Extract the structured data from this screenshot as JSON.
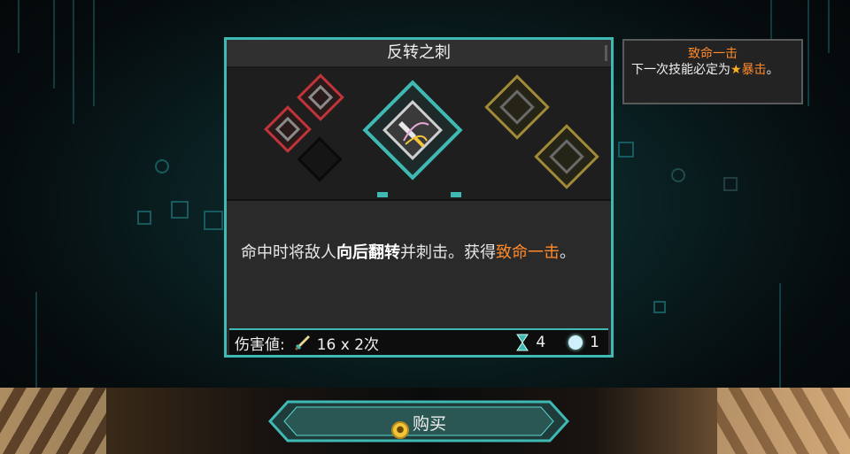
{
  "card": {
    "title": "反转之刺",
    "desc_1": "命中时将敌人",
    "desc_2": "向后翻转",
    "desc_3": "并刺击。获得",
    "desc_4": "致命一击",
    "desc_5": "。"
  },
  "stats": {
    "damage_label": "伤害値:",
    "damage_value": "16 x 2次",
    "cooldown": "4",
    "cost": "1"
  },
  "tooltip": {
    "title": "致命一击",
    "body_1": "下一次技能必定为",
    "star": "★",
    "keyword": "暴击",
    "body_2": "。"
  },
  "buy_button": {
    "label": "购买"
  },
  "icons": [
    "sword-icon",
    "hourglass-icon",
    "orb-icon",
    "coin-icon",
    "skill-art-icon"
  ],
  "colors": {
    "accent": "#3fb9b4",
    "crit": "#ff8a2a",
    "red_slot": "#c0343a",
    "gold_slot": "#a08a3a"
  }
}
